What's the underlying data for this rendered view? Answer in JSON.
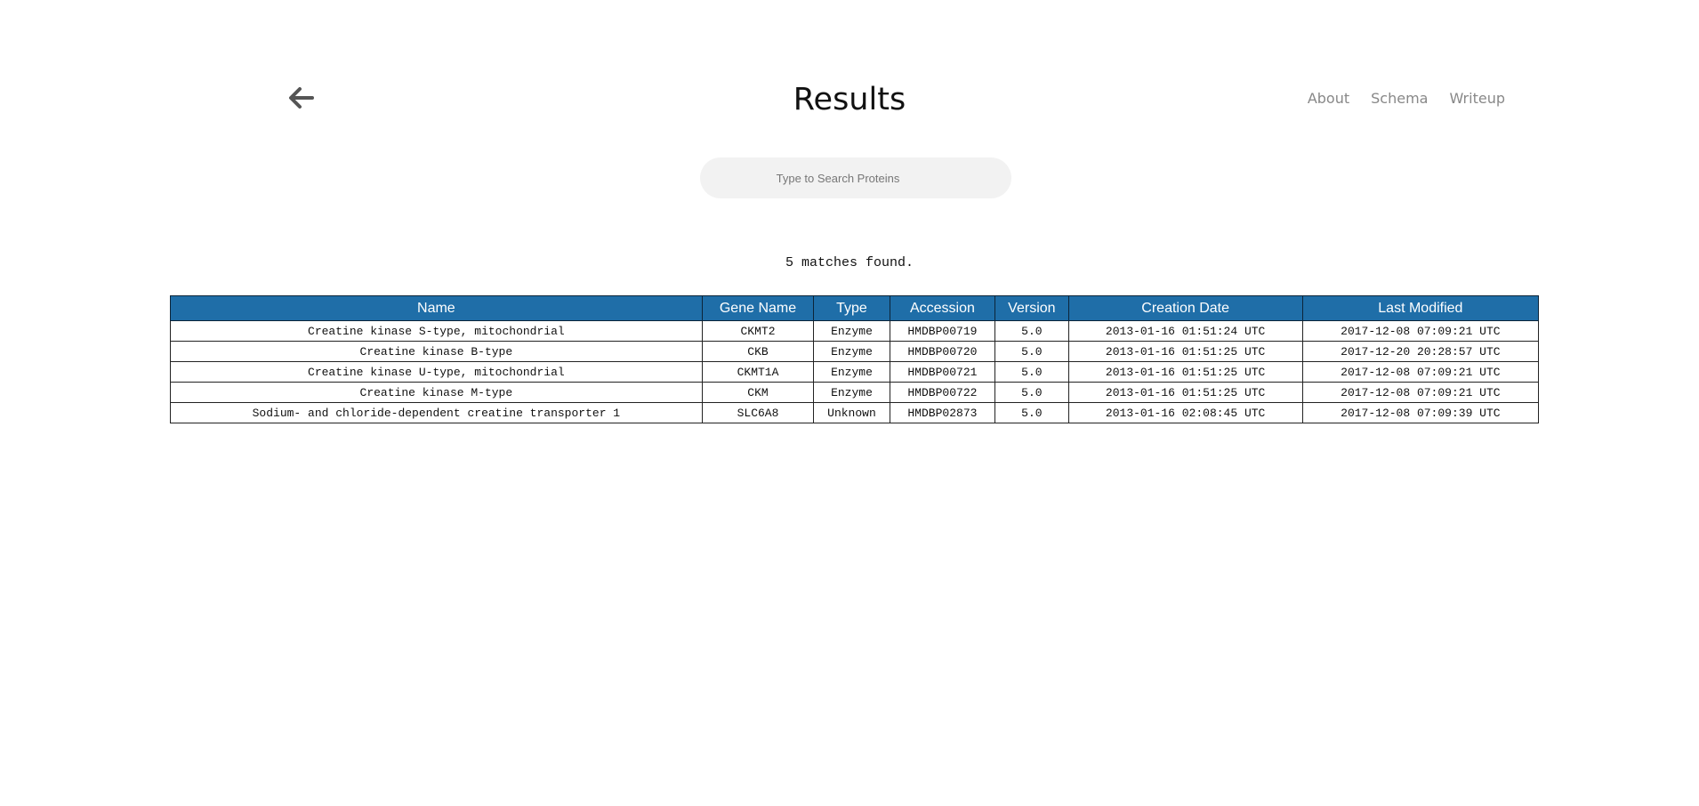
{
  "header": {
    "title": "Results",
    "back_icon": "arrow-left-icon",
    "nav": [
      "About",
      "Schema",
      "Writeup"
    ]
  },
  "search": {
    "placeholder": "Type to Search Proteins",
    "value": ""
  },
  "results": {
    "count_text": "5 matches found.",
    "columns": [
      "Name",
      "Gene Name",
      "Type",
      "Accession",
      "Version",
      "Creation Date",
      "Last Modified"
    ],
    "rows": [
      [
        "Creatine kinase S-type, mitochondrial",
        "CKMT2",
        "Enzyme",
        "HMDBP00719",
        "5.0",
        "2013-01-16 01:51:24 UTC",
        "2017-12-08 07:09:21 UTC"
      ],
      [
        "Creatine kinase B-type",
        "CKB",
        "Enzyme",
        "HMDBP00720",
        "5.0",
        "2013-01-16 01:51:25 UTC",
        "2017-12-20 20:28:57 UTC"
      ],
      [
        "Creatine kinase U-type, mitochondrial",
        "CKMT1A",
        "Enzyme",
        "HMDBP00721",
        "5.0",
        "2013-01-16 01:51:25 UTC",
        "2017-12-08 07:09:21 UTC"
      ],
      [
        "Creatine kinase M-type",
        "CKM",
        "Enzyme",
        "HMDBP00722",
        "5.0",
        "2013-01-16 01:51:25 UTC",
        "2017-12-08 07:09:21 UTC"
      ],
      [
        "Sodium- and chloride-dependent creatine transporter 1",
        "SLC6A8",
        "Unknown",
        "HMDBP02873",
        "5.0",
        "2013-01-16 02:08:45 UTC",
        "2017-12-08 07:09:39 UTC"
      ]
    ]
  },
  "colors": {
    "table_header_bg": "#1f6ea8",
    "nav_text": "#888888",
    "search_bg": "#f2f2f2"
  }
}
